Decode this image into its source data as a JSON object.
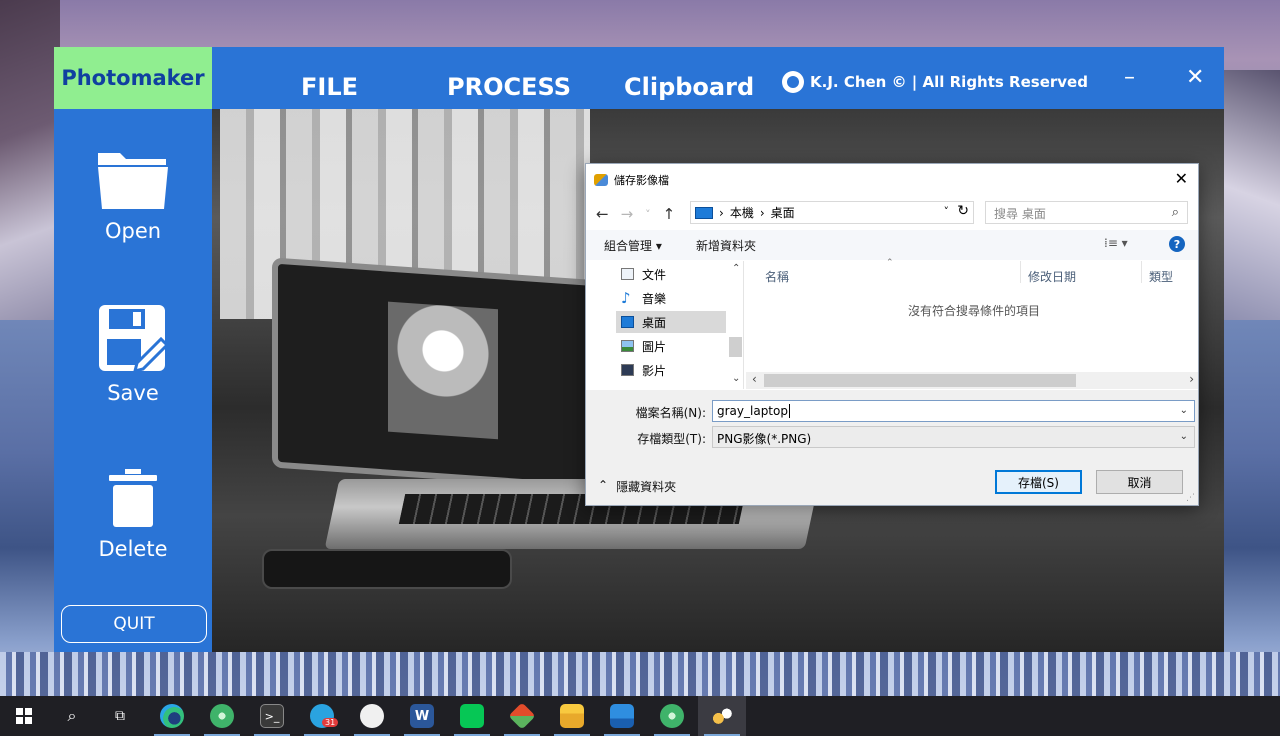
{
  "app": {
    "brand": "Photomaker",
    "menu": [
      "FILE",
      "PROCESS",
      "Clipboard"
    ],
    "credit": "K.J. Chen © | All Rights Reserved",
    "minimize_label": "–",
    "close_label": "✕",
    "sidebar": {
      "open_label": "Open",
      "save_label": "Save",
      "delete_label": "Delete",
      "quit_label": "QUIT"
    },
    "colors": {
      "primary": "#2a74d6",
      "brand_bg": "#90ee90",
      "brand_text": "#1040a0"
    }
  },
  "dialog": {
    "title": "儲存影像檔",
    "close_label": "✕",
    "nav": {
      "back": "←",
      "forward": "→",
      "recent": "˅",
      "up": "↑"
    },
    "path": [
      "本機",
      "桌面"
    ],
    "path_sep": "›",
    "refresh": "↻",
    "search_placeholder": "搜尋 桌面",
    "organize_label": "組合管理 ▾",
    "new_folder_label": "新增資料夾",
    "view_label": "⁞≡ ▾",
    "help_label": "?",
    "nav_items": [
      "文件",
      "音樂",
      "桌面",
      "圖片",
      "影片"
    ],
    "nav_selected": "桌面",
    "columns": [
      "名稱",
      "修改日期",
      "類型"
    ],
    "empty_message": "沒有符合搜尋條件的項目",
    "filename_label": "檔案名稱(N):",
    "filename_value": "gray_laptop",
    "filetype_label": "存檔類型(T):",
    "filetype_value": "PNG影像(*.PNG)",
    "hide_folders_label": "隱藏資料夾",
    "save_button": "存檔(S)",
    "cancel_button": "取消"
  },
  "taskbar": {
    "items": [
      "start",
      "search",
      "task-view",
      "edge",
      "atom",
      "terminal",
      "telegram",
      "wechat",
      "word",
      "line",
      "git",
      "file-explorer",
      "photos",
      "atom-2",
      "photomaker"
    ],
    "telegram_badge": "31"
  }
}
